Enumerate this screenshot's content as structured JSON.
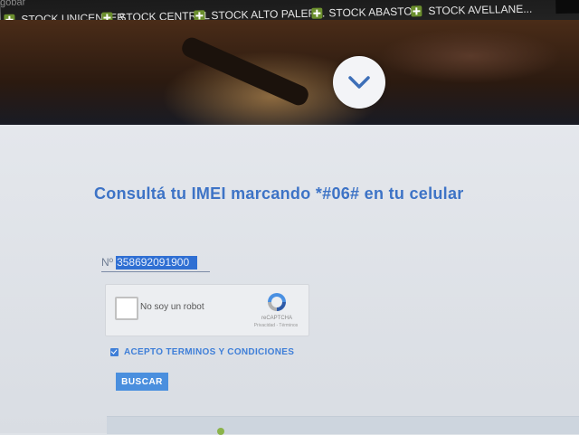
{
  "browser": {
    "address_fragment": "gobar",
    "bookmarks": [
      {
        "label": "STOCK UNICENTER",
        "icon": "stock-plus-icon"
      },
      {
        "label": "STOCK CENTRAL",
        "icon": "stock-plus-icon"
      },
      {
        "label": "STOCK ALTO PALER...",
        "icon": "stock-plus-icon"
      },
      {
        "label": "STOCK ABASTO",
        "icon": "stock-plus-icon"
      },
      {
        "label": "STOCK AVELLANE...",
        "icon": "stock-plus-icon"
      }
    ]
  },
  "hero": {
    "scroll_icon": "chevron-down-icon"
  },
  "form": {
    "title": "Consultá tu IMEI marcando *#06# en tu celular",
    "imei_prefix": "Nº",
    "imei_value": "358692091900",
    "captcha_label": "No soy un robot",
    "captcha_brand": "reCAPTCHA",
    "captcha_links": "Privacidad - Términos",
    "terms_label": "ACEPTO TERMINOS Y CONDICIONES",
    "terms_checked": true,
    "submit_label": "BUSCAR"
  },
  "colors": {
    "accent": "#3d73c6",
    "button": "#4a8fde",
    "selection": "#2f6fd3"
  }
}
